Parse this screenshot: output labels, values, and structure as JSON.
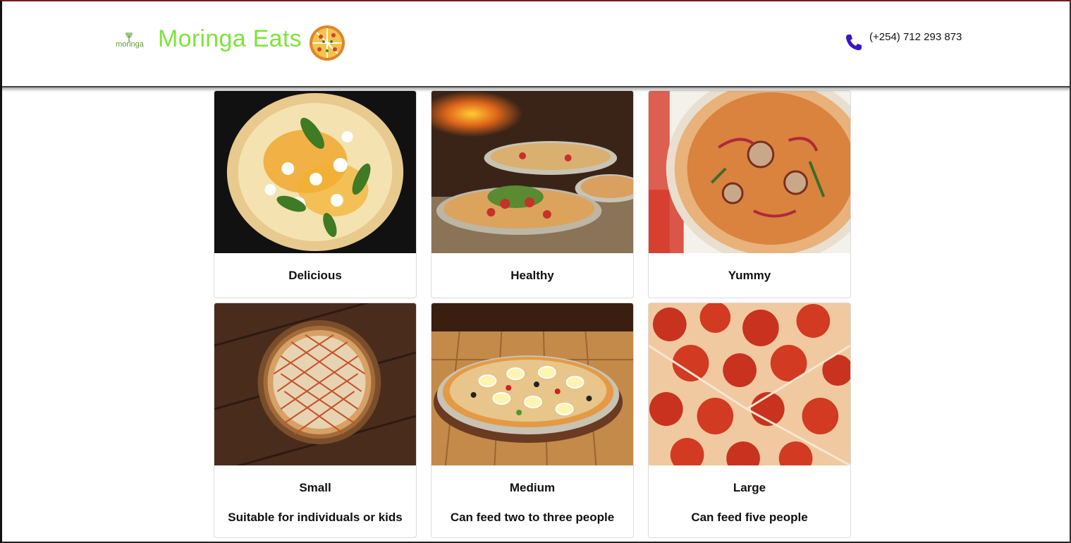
{
  "header": {
    "logo_text": "moringa",
    "title": "Moringa Eats",
    "phone": "(+254) 712 293 873"
  },
  "colors": {
    "brand_green": "#7fe33c",
    "phone_icon": "#3a16c9",
    "header_top_border": "#7a1a1a"
  },
  "icons": [
    "moringa-logo-icon",
    "pizza-icon",
    "phone-icon"
  ],
  "cards": [
    {
      "title": "Delicious",
      "description": ""
    },
    {
      "title": "Healthy",
      "description": ""
    },
    {
      "title": "Yummy",
      "description": ""
    },
    {
      "title": "Small",
      "description": "Suitable for individuals or kids"
    },
    {
      "title": "Medium",
      "description": "Can feed two to three people"
    },
    {
      "title": "Large",
      "description": "Can feed five people"
    }
  ]
}
